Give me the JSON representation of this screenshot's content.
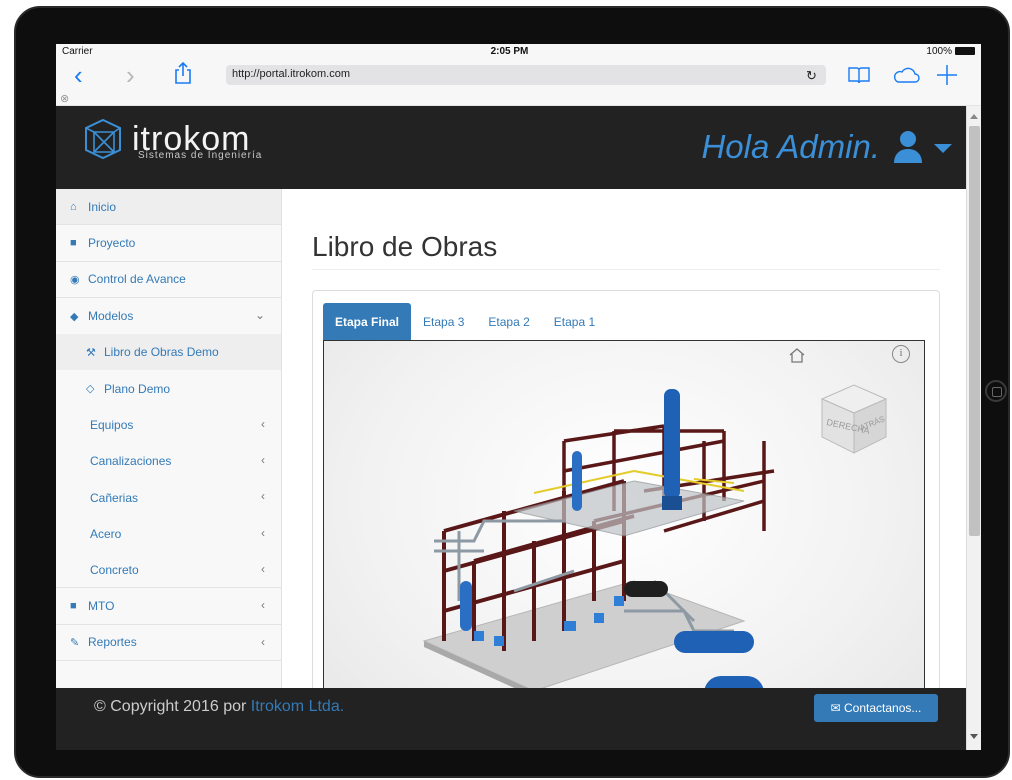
{
  "status_bar": {
    "carrier": "Carrier",
    "time": "2:05 PM",
    "battery": "100%"
  },
  "browser": {
    "url": "http://portal.itrokom.com"
  },
  "header": {
    "brand": "itrokom",
    "tagline": "Sistemas de Ingeniería",
    "greeting": "Hola Admin."
  },
  "sidebar": {
    "items": [
      {
        "label": "Inicio",
        "icon": "home-icon",
        "active": true
      },
      {
        "label": "Proyecto",
        "icon": "book-icon"
      },
      {
        "label": "Control de Avance",
        "icon": "dashboard-icon"
      },
      {
        "label": "Modelos",
        "icon": "cube-icon",
        "expanded": true
      },
      {
        "label": "Libro de Obras Demo",
        "icon": "wrench-icon",
        "sub": true,
        "selected": true
      },
      {
        "label": "Plano Demo",
        "icon": "diamond-icon",
        "sub": true
      },
      {
        "label": "Equipos",
        "sub": true
      },
      {
        "label": "Canalizaciones",
        "sub": true
      },
      {
        "label": "Cañerias",
        "sub": true
      },
      {
        "label": "Acero",
        "sub": true
      },
      {
        "label": "Concreto",
        "sub": true
      },
      {
        "label": "MTO",
        "icon": "book-icon"
      },
      {
        "label": "Reportes",
        "icon": "edit-icon"
      }
    ]
  },
  "main": {
    "title": "Libro de Obras",
    "tabs": [
      {
        "label": "Etapa Final",
        "active": true
      },
      {
        "label": "Etapa 3"
      },
      {
        "label": "Etapa 2"
      },
      {
        "label": "Etapa 1"
      }
    ],
    "viewcube": {
      "face_front": "DERECHA",
      "face_side": "ATRÁS"
    }
  },
  "footer": {
    "copyright_prefix": "© Copyright 2016 por",
    "company": "Itrokom Ltda.",
    "contact_label": "Contactanos..."
  },
  "colors": {
    "accent": "#337ab7",
    "header_bg": "#222222",
    "greeting": "#3a8fd6"
  }
}
